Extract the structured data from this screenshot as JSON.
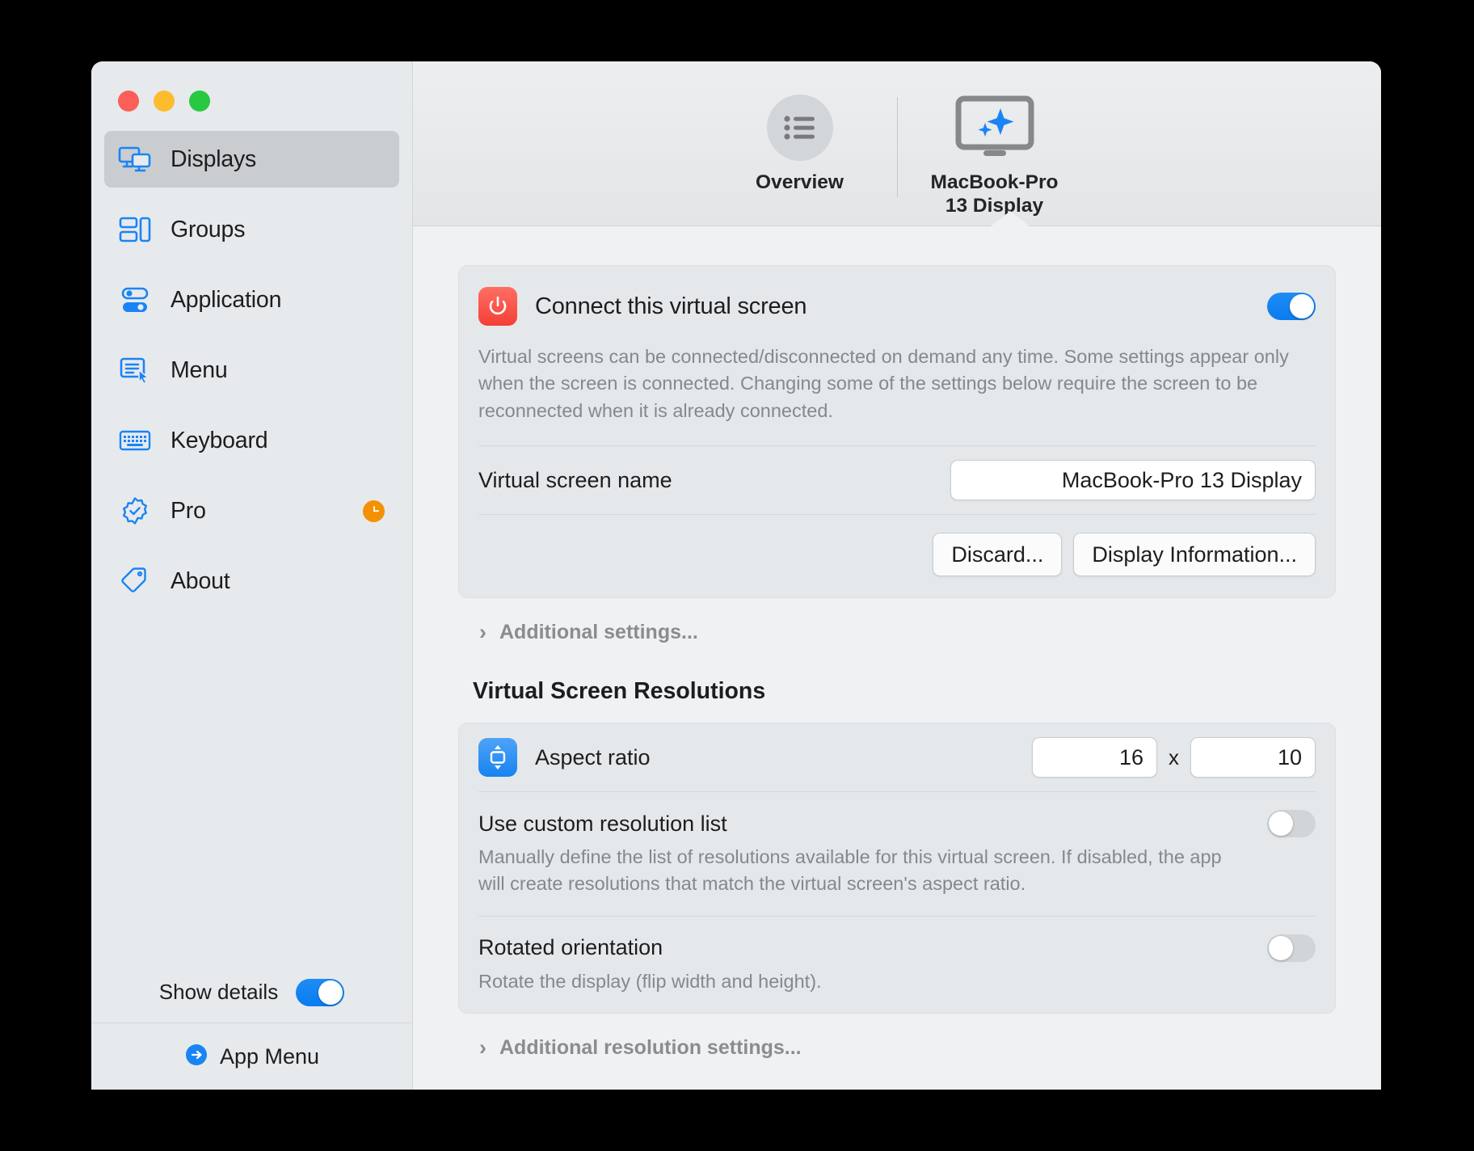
{
  "sidebar": {
    "items": [
      {
        "label": "Displays",
        "icon": "displays-icon",
        "active": true
      },
      {
        "label": "Groups",
        "icon": "groups-icon",
        "active": false
      },
      {
        "label": "Application",
        "icon": "application-icon",
        "active": false
      },
      {
        "label": "Menu",
        "icon": "menu-icon",
        "active": false
      },
      {
        "label": "Keyboard",
        "icon": "keyboard-icon",
        "active": false
      },
      {
        "label": "Pro",
        "icon": "pro-badge-icon",
        "active": false,
        "badge": "clock-badge"
      },
      {
        "label": "About",
        "icon": "about-tag-icon",
        "active": false
      }
    ],
    "show_details_label": "Show details",
    "show_details_value": "on",
    "app_menu_label": "App Menu"
  },
  "toolbar": {
    "tabs": [
      {
        "label": "Overview",
        "icon": "list-circle-icon",
        "selected": false
      },
      {
        "label": "MacBook-Pro\n13 Display",
        "label_line1": "MacBook-Pro",
        "label_line2": "13 Display",
        "icon": "display-sparkle-icon",
        "selected": true
      }
    ]
  },
  "connect_card": {
    "title": "Connect this virtual screen",
    "icon": "power-icon",
    "toggle": "on",
    "description": "Virtual screens can be connected/disconnected on demand any time. Some settings appear only when the screen is connected. Changing some of the settings below require the screen to be reconnected when it is already connected.",
    "name_row_label": "Virtual screen name",
    "name_value": "MacBook-Pro 13 Display",
    "buttons": [
      {
        "label": "Discard..."
      },
      {
        "label": "Display Information..."
      }
    ]
  },
  "additional_settings_label": "Additional settings...",
  "resolutions": {
    "section_title": "Virtual Screen Resolutions",
    "aspect_ratio": {
      "label": "Aspect ratio",
      "icon": "aspect-ratio-icon",
      "width": "16",
      "separator": "x",
      "height": "10"
    },
    "custom_list": {
      "name": "Use custom resolution list",
      "description": "Manually define the list of resolutions available for this virtual screen. If disabled, the app will create resolutions that match the virtual screen's aspect ratio.",
      "toggle": "off"
    },
    "rotated": {
      "name": "Rotated orientation",
      "description": "Rotate the display (flip width and height).",
      "toggle": "off"
    },
    "additional_resolution_settings_label": "Additional resolution settings..."
  }
}
